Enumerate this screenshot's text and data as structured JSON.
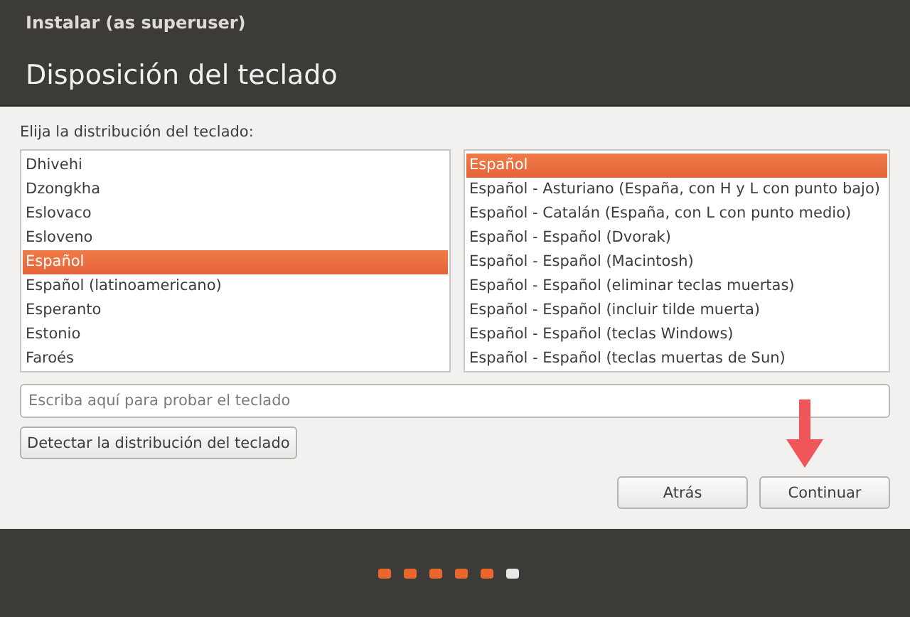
{
  "window": {
    "title": "Instalar (as superuser)"
  },
  "page_title": "Disposición del teclado",
  "prompt": "Elija la distribución del teclado:",
  "layouts": [
    {
      "label": "Dhivehi",
      "selected": false
    },
    {
      "label": "Dzongkha",
      "selected": false
    },
    {
      "label": "Eslovaco",
      "selected": false
    },
    {
      "label": "Esloveno",
      "selected": false
    },
    {
      "label": "Español",
      "selected": true
    },
    {
      "label": "Español (latinoamericano)",
      "selected": false
    },
    {
      "label": "Esperanto",
      "selected": false
    },
    {
      "label": "Estonio",
      "selected": false
    },
    {
      "label": "Faroés",
      "selected": false
    }
  ],
  "variants": [
    {
      "label": "Español",
      "selected": true
    },
    {
      "label": "Español - Asturiano (España, con H y L con punto bajo)",
      "selected": false
    },
    {
      "label": "Español - Catalán (España, con L con punto medio)",
      "selected": false
    },
    {
      "label": "Español - Español (Dvorak)",
      "selected": false
    },
    {
      "label": "Español - Español (Macintosh)",
      "selected": false
    },
    {
      "label": "Español - Español (eliminar teclas muertas)",
      "selected": false
    },
    {
      "label": "Español - Español (incluir tilde muerta)",
      "selected": false
    },
    {
      "label": "Español - Español (teclas Windows)",
      "selected": false
    },
    {
      "label": "Español - Español (teclas muertas de Sun)",
      "selected": false
    }
  ],
  "test_field": {
    "placeholder": "Escriba aquí para probar el teclado"
  },
  "detect_button": "Detectar la distribución del teclado",
  "buttons": [
    "Atrás",
    "Continuar"
  ],
  "progress_steps": [
    {
      "done": true
    },
    {
      "done": true
    },
    {
      "done": true
    },
    {
      "done": true
    },
    {
      "done": true
    },
    {
      "done": false
    }
  ]
}
